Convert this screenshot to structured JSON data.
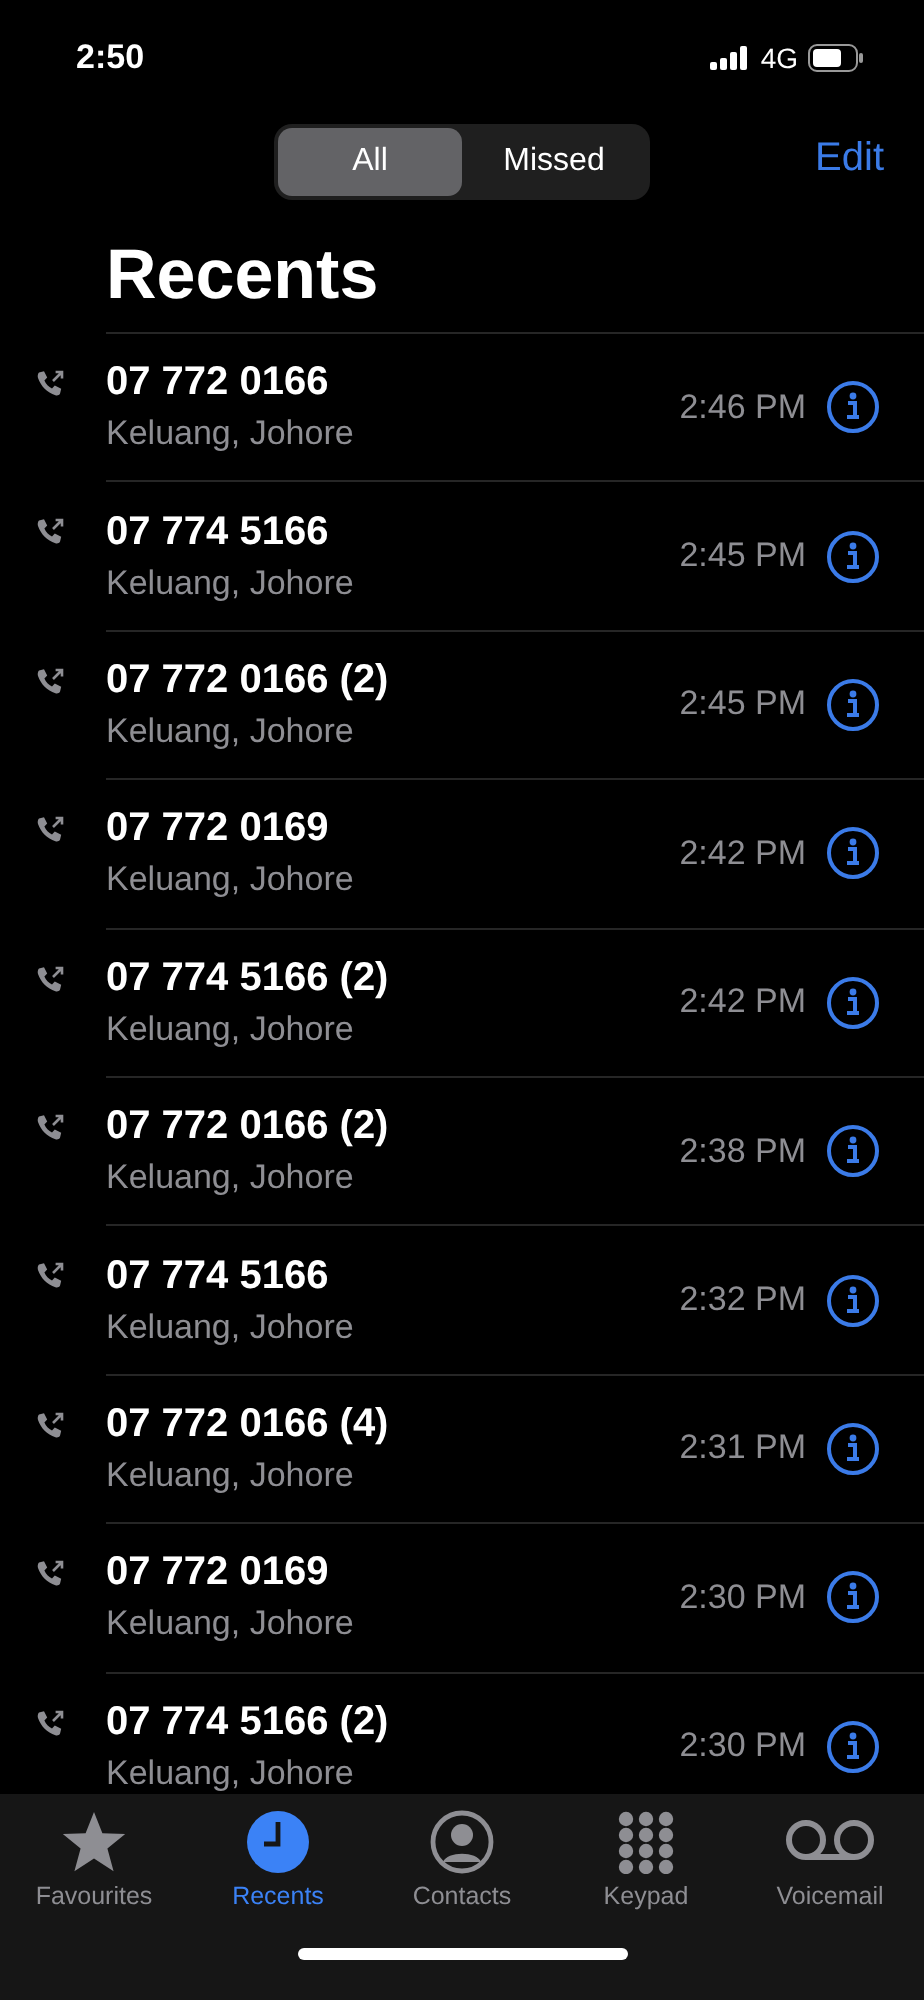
{
  "status_bar": {
    "time": "2:50",
    "network": "4G"
  },
  "segments": [
    {
      "label": "All",
      "selected": true
    },
    {
      "label": "Missed",
      "selected": false
    }
  ],
  "edit_button": "Edit",
  "title": "Recents",
  "calls": [
    {
      "number": "07 772 0166",
      "location": "Keluang, Johore",
      "time": "2:46 PM"
    },
    {
      "number": "07 774 5166",
      "location": "Keluang, Johore",
      "time": "2:45 PM"
    },
    {
      "number": "07 772 0166 (2)",
      "location": "Keluang, Johore",
      "time": "2:45 PM"
    },
    {
      "number": "07 772 0169",
      "location": "Keluang, Johore",
      "time": "2:42 PM"
    },
    {
      "number": "07 774 5166 (2)",
      "location": "Keluang, Johore",
      "time": "2:42 PM"
    },
    {
      "number": "07 772 0166 (2)",
      "location": "Keluang, Johore",
      "time": "2:38 PM"
    },
    {
      "number": "07 774 5166",
      "location": "Keluang, Johore",
      "time": "2:32 PM"
    },
    {
      "number": "07 772 0166 (4)",
      "location": "Keluang, Johore",
      "time": "2:31 PM"
    },
    {
      "number": "07 772 0169",
      "location": "Keluang, Johore",
      "time": "2:30 PM"
    },
    {
      "number": "07 774 5166 (2)",
      "location": "Keluang, Johore",
      "time": "2:30 PM"
    }
  ],
  "tab_bar": [
    {
      "kind": "star",
      "label": "Favourites",
      "selected": false
    },
    {
      "kind": "clock",
      "label": "Recents",
      "selected": true
    },
    {
      "kind": "person",
      "label": "Contacts",
      "selected": false
    },
    {
      "kind": "keypad",
      "label": "Keypad",
      "selected": false
    },
    {
      "kind": "voicemail",
      "label": "Voicemail",
      "selected": false
    }
  ]
}
